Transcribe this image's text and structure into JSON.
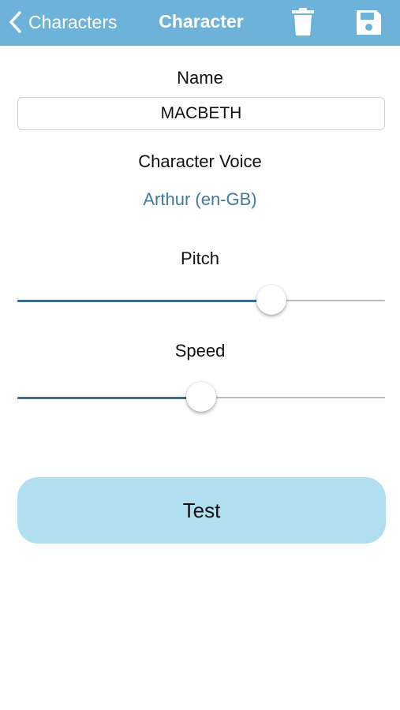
{
  "navbar": {
    "back_label": "Characters",
    "title": "Character",
    "icons": {
      "back": "chevron-left-icon",
      "delete": "trash-icon",
      "save": "save-icon"
    },
    "background_color": "#6db3d9",
    "text_color": "#ffffff"
  },
  "form": {
    "name_label": "Name",
    "name_value": "MACBETH",
    "voice_label": "Character Voice",
    "voice_value": "Arthur (en-GB)",
    "voice_color": "#3f7b9e",
    "pitch_label": "Pitch",
    "pitch_level": 0.69,
    "speed_label": "Speed",
    "speed_level": 0.5
  },
  "actions": {
    "test_label": "Test",
    "test_color": "#b1dff0"
  }
}
